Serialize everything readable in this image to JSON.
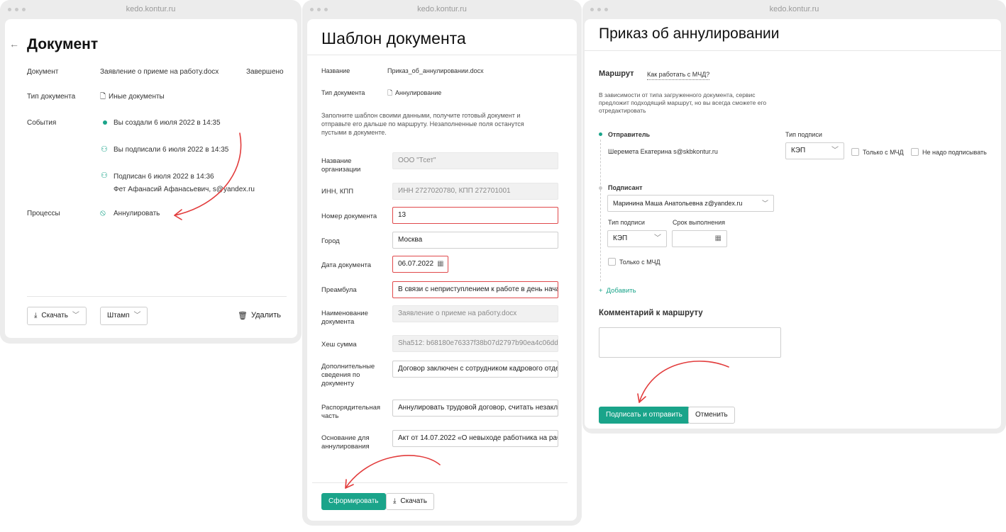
{
  "url": "kedo.kontur.ru",
  "panel1": {
    "title": "Документ",
    "doc_label": "Документ",
    "doc_value": "Заявление о приеме на работу.docx",
    "doc_status": "Завершено",
    "type_label": "Тип документа",
    "type_value": "Иные документы",
    "events_label": "События",
    "events": [
      {
        "text": "Вы создали 6 июля 2022 в 14:35",
        "sub": ""
      },
      {
        "text": "Вы подписали 6 июля 2022 в 14:35",
        "sub": ""
      },
      {
        "text": "Подписан 6 июля 2022 в 14:36",
        "sub": "Фет Афанасий Афанасьевич, s@yandex.ru"
      }
    ],
    "processes_label": "Процессы",
    "processes_link": "Аннулировать",
    "download_label": "Скачать",
    "stamp_label": "Штамп",
    "delete_label": "Удалить"
  },
  "panel2": {
    "title": "Шаблон документа",
    "name_label": "Название",
    "name_value": "Приказ_об_аннулировании.docx",
    "type_label": "Тип документа",
    "type_value": "Аннулирование",
    "hint": "Заполните шаблон своими данными, получите готовый документ и отправьте его дальше по маршруту. Незаполненные поля останутся пустыми в документе.",
    "fields": [
      {
        "label": "Название организации",
        "value": "ООО \"Тсет\""
      },
      {
        "label": "ИНН, КПП",
        "value": "ИНН 2727020780, КПП 272701001"
      },
      {
        "label": "Номер документа",
        "value": "13"
      },
      {
        "label": "Город",
        "value": "Москва"
      },
      {
        "label": "Дата документа",
        "value": "06.07.2022"
      },
      {
        "label": "Преамбула",
        "value": "В связи с неприступлением  к работе в день нача"
      },
      {
        "label": "Наименование документа",
        "value": "Заявление о приеме на работу.docx"
      },
      {
        "label": "Хеш сумма",
        "value": "Sha512: b68180e76337f38b07d2797b90ea4c06dd"
      },
      {
        "label": "Дополнительные сведения по документу",
        "value": "Договор заключен с сотрудником кадрового отде"
      },
      {
        "label": "Распорядительная часть",
        "value": "Аннулировать трудовой договор, считать незаклк"
      },
      {
        "label": "Основание для аннулирования",
        "value": "Акт от 14.07.2022 «О невыходе работника на рабс"
      }
    ],
    "form_button": "Сформировать",
    "download_button": "Скачать"
  },
  "panel3": {
    "title": "Приказ об аннулировании",
    "route_label": "Маршрут",
    "route_link": "Как работать с МЧД?",
    "route_hint": "В зависимости от типа загруженного документа, сервис предложит подходящий маршрут, но вы всегда сможете его отредактировать",
    "sender_label": "Отправитель",
    "sender_value": "Шеремета Екатерина s@skbkontur.ru",
    "sign_type_label": "Тип подписи",
    "sign_type_value": "КЭП",
    "only_mchd": "Только с МЧД",
    "no_sign": "Не надо подписывать",
    "signer_label": "Подписант",
    "signer_value": "Маринина Маша Анатольевна z@yandex.ru",
    "signer_type_label": "Тип подписи",
    "signer_type_value": "КЭП",
    "deadline_label": "Срок выполнения",
    "signer_only_mchd": "Только с МЧД",
    "add_label": "Добавить",
    "comment_label": "Комментарий к маршруту",
    "sign_send_button": "Подписать и отправить",
    "cancel_button": "Отменить"
  },
  "colors": {
    "accent": "#1aa48a",
    "error": "#e0494b",
    "arrow": "#e23c3c"
  }
}
